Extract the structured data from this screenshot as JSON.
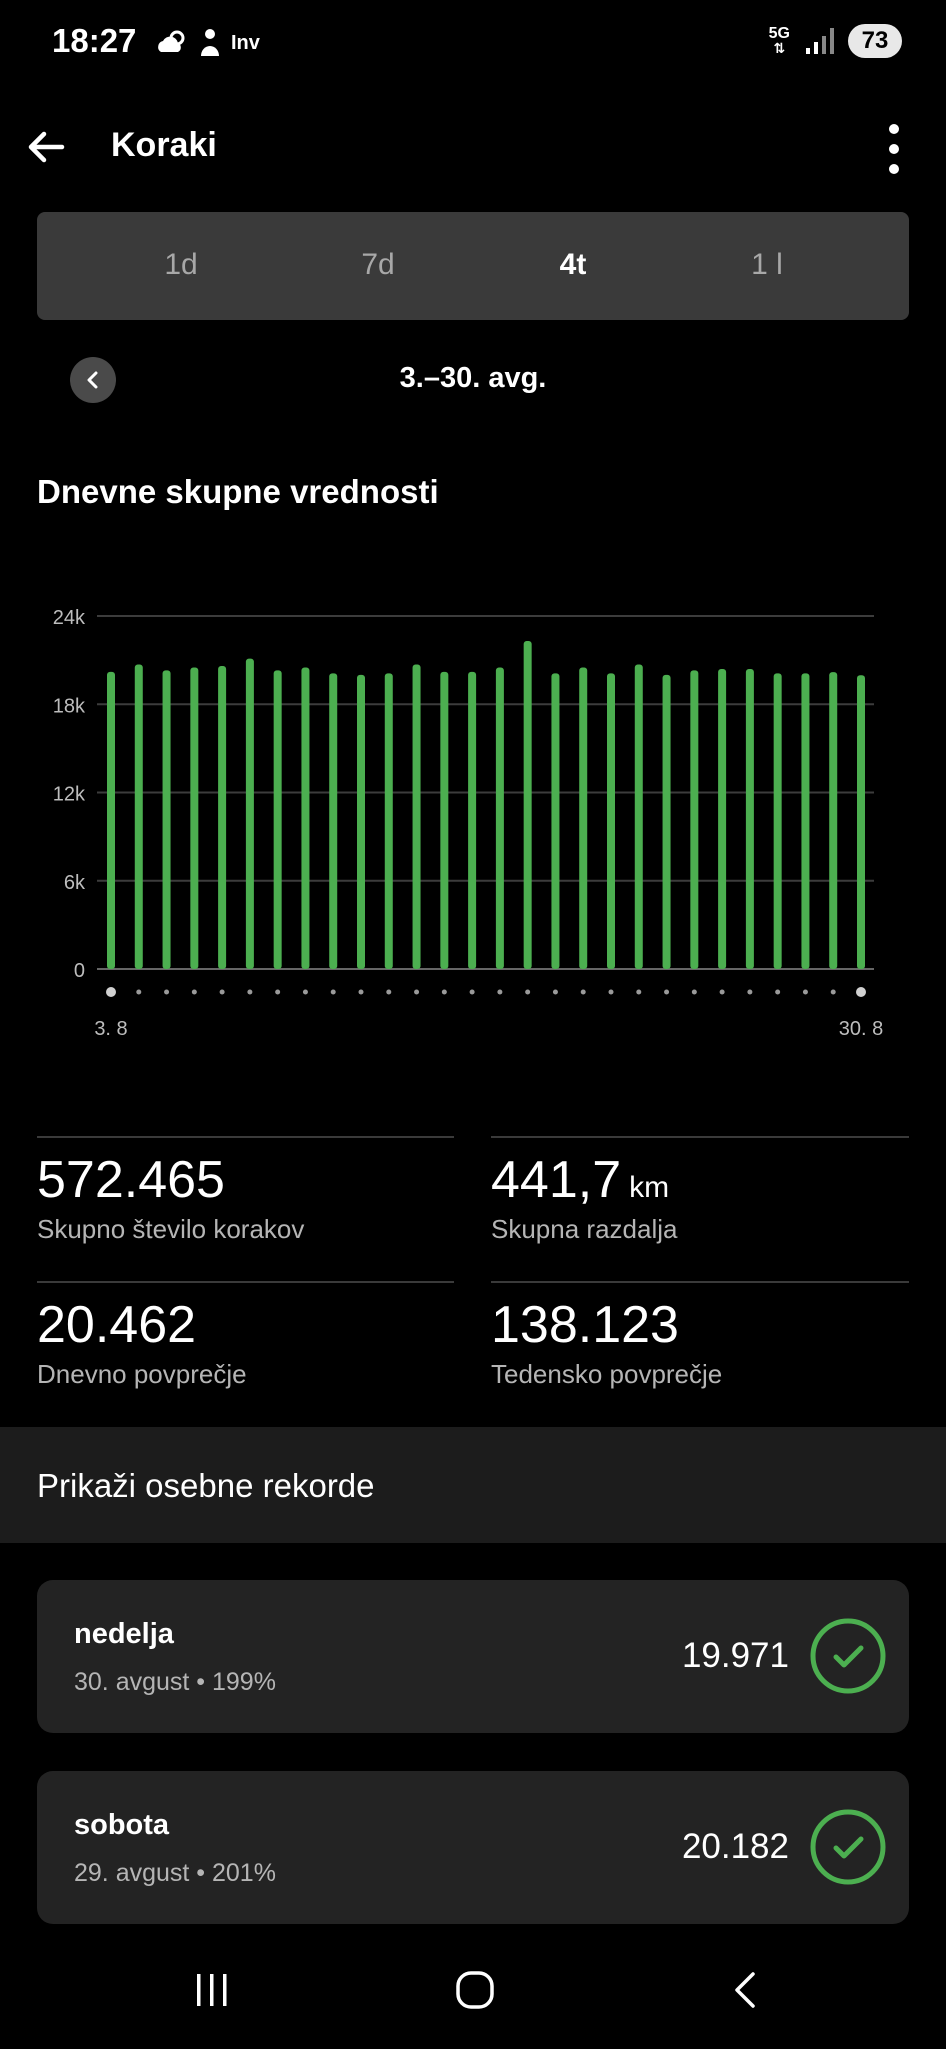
{
  "status_bar": {
    "time": "18:27",
    "left_icons": [
      "weather-icon",
      "person-icon"
    ],
    "left_text": "Inv",
    "network": "5G",
    "battery": "73"
  },
  "app_bar": {
    "title": "Koraki"
  },
  "tabs": [
    {
      "label": "1d",
      "active": false
    },
    {
      "label": "7d",
      "active": false
    },
    {
      "label": "4t",
      "active": true
    },
    {
      "label": "1 l",
      "active": false
    }
  ],
  "date_range": "3.–30. avg.",
  "section_title": "Dnevne skupne vrednosti",
  "chart_data": {
    "type": "bar",
    "title": "Dnevne skupne vrednosti",
    "x_start_label": "3. 8",
    "x_end_label": "30. 8",
    "y_ticks": [
      "24k",
      "18k",
      "12k",
      "6k",
      "0"
    ],
    "ylim": [
      0,
      24000
    ],
    "grid": true,
    "bar_color": "#4caf50",
    "values": [
      20200,
      20700,
      20300,
      20500,
      20600,
      21100,
      20300,
      20500,
      20100,
      20000,
      20100,
      20700,
      20200,
      20200,
      20500,
      22300,
      20100,
      20500,
      20100,
      20700,
      20000,
      20300,
      20400,
      20400,
      20100,
      20100,
      20182,
      19971
    ]
  },
  "stats": {
    "total_steps": {
      "value": "572.465",
      "label": "Skupno število korakov"
    },
    "total_distance": {
      "value": "441,7",
      "unit": "km",
      "label": "Skupna razdalja"
    },
    "daily_avg": {
      "value": "20.462",
      "label": "Dnevno povprečje"
    },
    "weekly_avg": {
      "value": "138.123",
      "label": "Tedensko povprečje"
    }
  },
  "records_header": "Prikaži osebne rekorde",
  "records": [
    {
      "day": "nedelja",
      "sub": "30. avgust • 199%",
      "value": "19.971"
    },
    {
      "day": "sobota",
      "sub": "29. avgust • 201%",
      "value": "20.182"
    }
  ],
  "colors": {
    "accent": "#4caf50",
    "background": "#000000",
    "card": "#232323"
  }
}
